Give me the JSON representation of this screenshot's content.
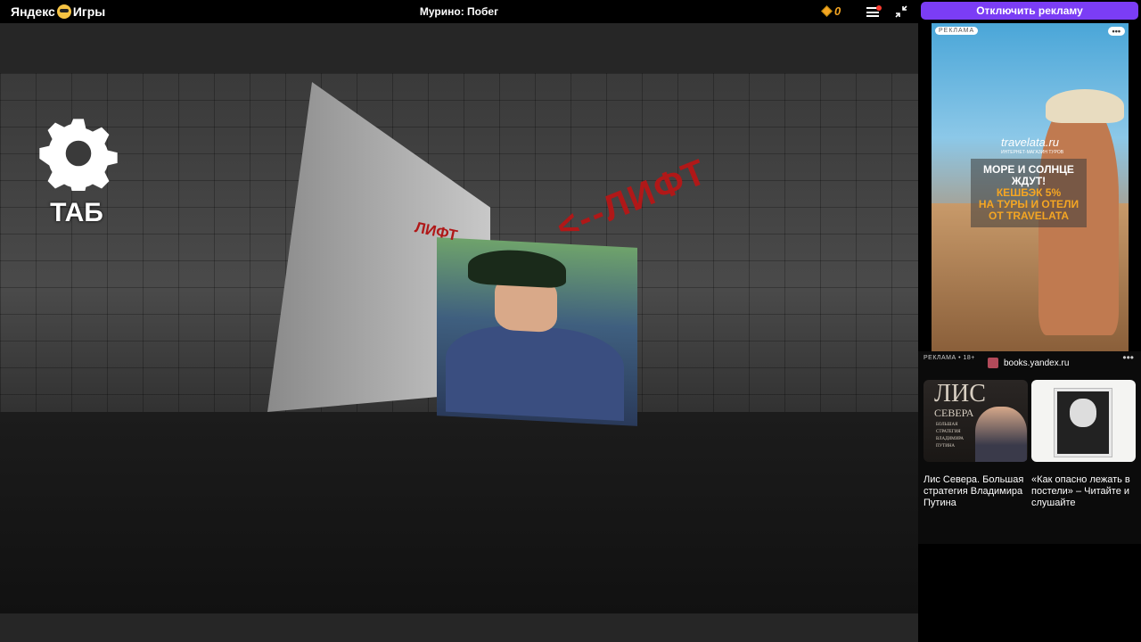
{
  "topbar": {
    "logo_left": "Яндекс",
    "logo_right": "Игры",
    "game_title": "Мурино: Побег",
    "coins": "0"
  },
  "game": {
    "settings_label": "ТАБ",
    "graffiti_small": "ЛИФТ",
    "graffiti_large": "<--ЛИФТ"
  },
  "ads": {
    "disable_ads_label": "Отключить рекламу",
    "banner": {
      "tag": "РЕКЛАМА",
      "dots": "•••",
      "brand": "travelata.ru",
      "brand_sub": "ИНТЕРНЕТ-МАГАЗИН ТУРОВ",
      "promo_line1": "МОРЕ И СОЛНЦЕ",
      "promo_line2": "ЖДУТ!",
      "promo_line3": "КЕШБЭК 5%",
      "promo_line4": "НА ТУРЫ И ОТЕЛИ",
      "promo_line5": "ОТ TRAVELATA"
    },
    "books": {
      "ad_label": "РЕКЛАМА • 18+",
      "source": "books.yandex.ru",
      "more": "•••",
      "cards": [
        {
          "cover_title": "ЛИС",
          "cover_subtitle": "СЕВЕРА",
          "cover_text": "БОЛЬШАЯ СТРАТЕГИЯ ВЛАДИМИРА ПУТИНА",
          "caption": "Лис Севера. Большая стратегия Владимира Путина"
        },
        {
          "caption": "«Как опасно лежать в постели» – Читайте и слушайте"
        }
      ]
    }
  },
  "colors": {
    "accent": "#7b3df5",
    "coin": "#f5a623",
    "graffiti": "#b01818"
  }
}
